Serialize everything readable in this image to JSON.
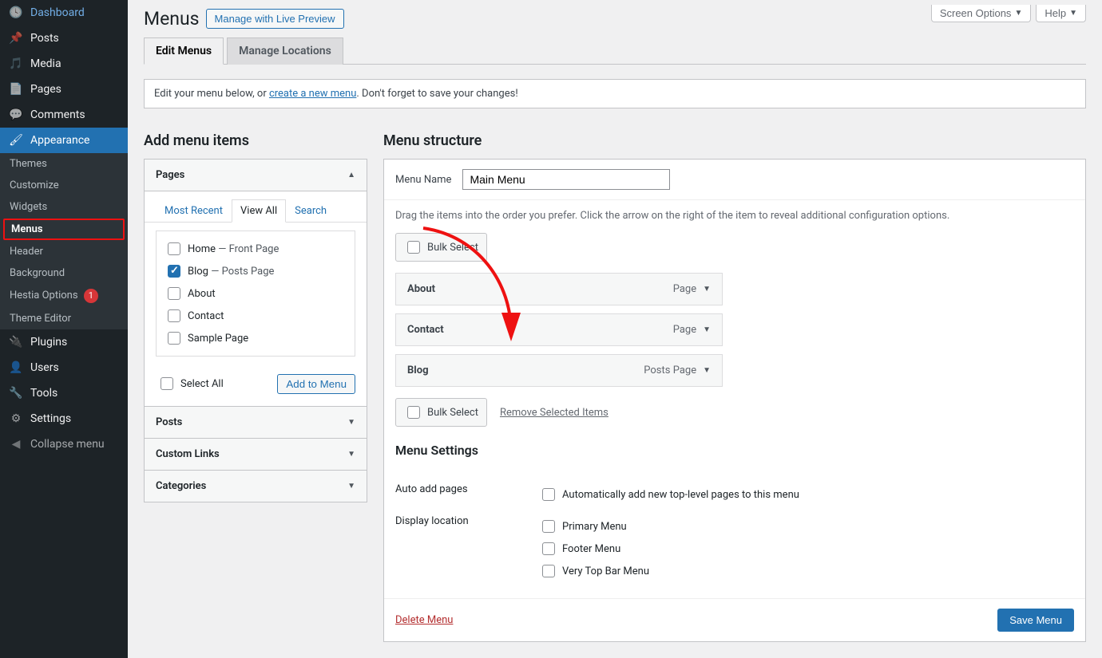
{
  "topButtons": {
    "screenOptions": "Screen Options",
    "help": "Help"
  },
  "sidebar": {
    "items": [
      {
        "icon": "gauge-icon",
        "label": "Dashboard"
      },
      {
        "icon": "pin-icon",
        "label": "Posts"
      },
      {
        "icon": "media-icon",
        "label": "Media"
      },
      {
        "icon": "page-icon",
        "label": "Pages"
      },
      {
        "icon": "comment-icon",
        "label": "Comments"
      },
      {
        "icon": "brush-icon",
        "label": "Appearance",
        "current": true
      },
      {
        "icon": "plug-icon",
        "label": "Plugins"
      },
      {
        "icon": "user-icon",
        "label": "Users"
      },
      {
        "icon": "wrench-icon",
        "label": "Tools"
      },
      {
        "icon": "sliders-icon",
        "label": "Settings"
      },
      {
        "icon": "collapse-icon",
        "label": "Collapse menu"
      }
    ],
    "appearanceSub": [
      {
        "label": "Themes"
      },
      {
        "label": "Customize"
      },
      {
        "label": "Widgets"
      },
      {
        "label": "Menus",
        "highlight": true
      },
      {
        "label": "Header"
      },
      {
        "label": "Background"
      },
      {
        "label": "Hestia Options",
        "badge": "1"
      },
      {
        "label": "Theme Editor"
      }
    ]
  },
  "page": {
    "title": "Menus",
    "livePreviewBtn": "Manage with Live Preview",
    "tabs": {
      "edit": "Edit Menus",
      "locations": "Manage Locations"
    },
    "notice": {
      "pre": "Edit your menu below, or ",
      "link": "create a new menu",
      "post": ". Don't forget to save your changes!"
    }
  },
  "addItems": {
    "heading": "Add menu items",
    "sections": {
      "pages": "Pages",
      "posts": "Posts",
      "customLinks": "Custom Links",
      "categories": "Categories"
    },
    "innerTabs": {
      "recent": "Most Recent",
      "viewAll": "View All",
      "search": "Search"
    },
    "pageOptions": [
      {
        "label": "Home",
        "suffix": " — Front Page",
        "checked": false
      },
      {
        "label": "Blog",
        "suffix": " — Posts Page",
        "checked": true
      },
      {
        "label": "About",
        "suffix": "",
        "checked": false
      },
      {
        "label": "Contact",
        "suffix": "",
        "checked": false
      },
      {
        "label": "Sample Page",
        "suffix": "",
        "checked": false
      }
    ],
    "selectAll": "Select All",
    "addBtn": "Add to Menu"
  },
  "structure": {
    "heading": "Menu structure",
    "menuNameLabel": "Menu Name",
    "menuNameValue": "Main Menu",
    "instructions": "Drag the items into the order you prefer. Click the arrow on the right of the item to reveal additional configuration options.",
    "bulkSelect": "Bulk Select",
    "removeSelected": "Remove Selected Items",
    "items": [
      {
        "title": "About",
        "type": "Page"
      },
      {
        "title": "Contact",
        "type": "Page"
      },
      {
        "title": "Blog",
        "type": "Posts Page"
      }
    ],
    "settings": {
      "heading": "Menu Settings",
      "autoAddLabel": "Auto add pages",
      "autoAddOption": "Automatically add new top-level pages to this menu",
      "displayLocLabel": "Display location",
      "locations": [
        "Primary Menu",
        "Footer Menu",
        "Very Top Bar Menu"
      ]
    },
    "deleteMenu": "Delete Menu",
    "saveMenu": "Save Menu"
  },
  "iconGlyphs": {
    "gauge-icon": "🕓",
    "pin-icon": "📌",
    "media-icon": "🎵",
    "page-icon": "📄",
    "comment-icon": "💬",
    "brush-icon": "🖌",
    "plug-icon": "🔌",
    "user-icon": "👤",
    "wrench-icon": "🔧",
    "sliders-icon": "⚙",
    "collapse-icon": "◀"
  }
}
